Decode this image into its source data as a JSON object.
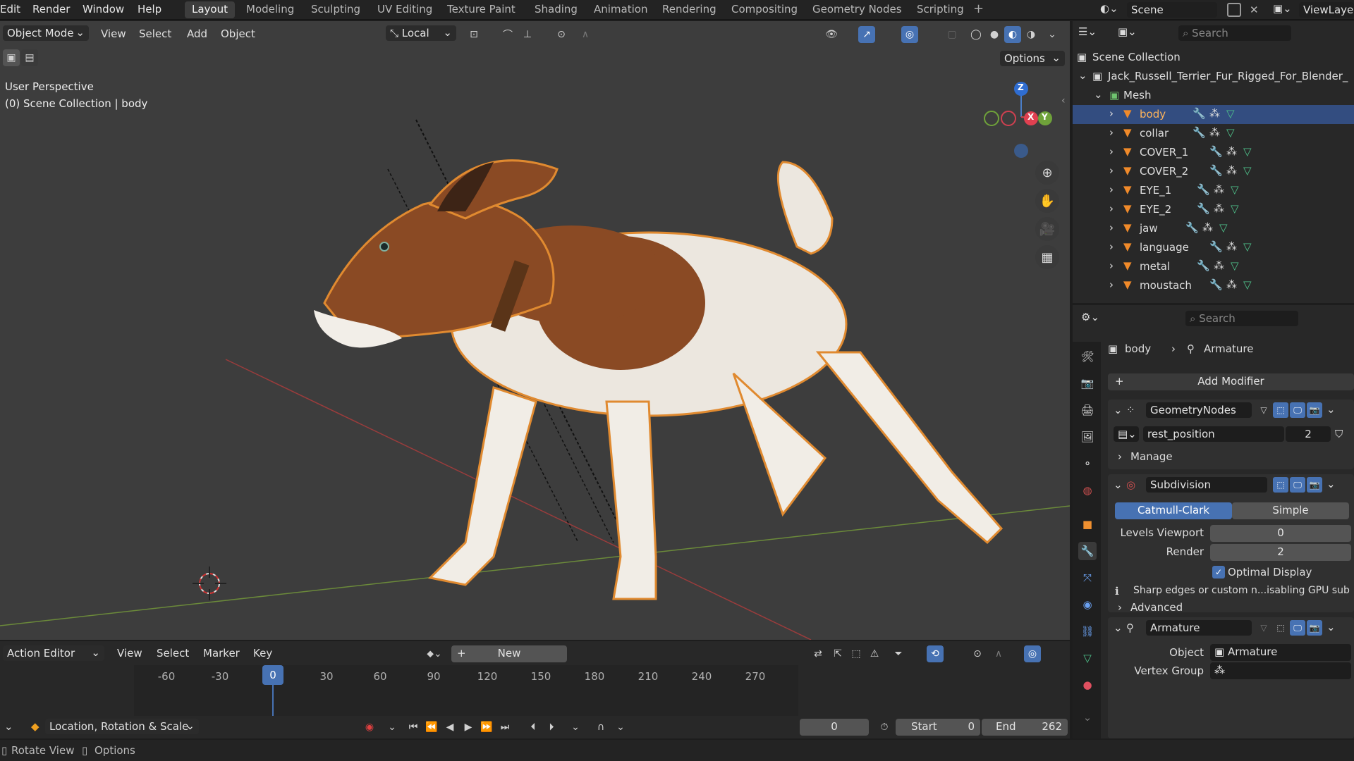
{
  "topmenu": {
    "edit": "Edit",
    "render": "Render",
    "window": "Window",
    "help": "Help"
  },
  "workspaces": [
    "Layout",
    "Modeling",
    "Sculpting",
    "UV Editing",
    "Texture Paint",
    "Shading",
    "Animation",
    "Rendering",
    "Compositing",
    "Geometry Nodes",
    "Scripting"
  ],
  "scene": {
    "label": "Scene",
    "viewlayer": "ViewLaye"
  },
  "viewport": {
    "mode": "Object Mode",
    "menus": {
      "view": "View",
      "select": "Select",
      "add": "Add",
      "object": "Object"
    },
    "orientation": "Local",
    "options": "Options",
    "perspective": "User Perspective",
    "collection_info": "(0) Scene Collection | body",
    "gizmo": {
      "z": "Z",
      "x": "X",
      "y": "Y"
    }
  },
  "outliner": {
    "search_placeholder": "Search",
    "scene_collection": "Scene Collection",
    "root": "Jack_Russell_Terrier_Fur_Rigged_For_Blender_",
    "mesh": "Mesh",
    "objects": [
      "body",
      "collar",
      "COVER_1",
      "COVER_2",
      "EYE_1",
      "EYE_2",
      "jaw",
      "language",
      "metal",
      "moustach"
    ]
  },
  "properties": {
    "search_placeholder": "Search",
    "breadcrumb_obj": "body",
    "breadcrumb_mod": "Armature",
    "add_modifier": "Add Modifier",
    "geonodes": {
      "name": "GeometryNodes",
      "attribute": "rest_position",
      "users": "2",
      "manage": "Manage"
    },
    "subdivision": {
      "name": "Subdivision",
      "catmull": "Catmull-Clark",
      "simple": "Simple",
      "levels_label": "Levels Viewport",
      "levels": "0",
      "render_label": "Render",
      "render": "2",
      "optimal": "Optimal Display",
      "warning": "Sharp edges or custom n...isabling GPU sub",
      "advanced": "Advanced"
    },
    "armature": {
      "name": "Armature",
      "object_label": "Object",
      "object": "Armature",
      "vgroup_label": "Vertex Group"
    }
  },
  "timeline": {
    "editor": "Action Editor",
    "menus": {
      "view": "View",
      "select": "Select",
      "marker": "Marker",
      "key": "Key"
    },
    "new": "New",
    "ticks": [
      "-60",
      "-30",
      "0",
      "30",
      "60",
      "90",
      "120",
      "150",
      "180",
      "210",
      "240",
      "270"
    ],
    "current": "0",
    "keying": "Location, Rotation & Scale",
    "frame": "0",
    "start_label": "Start",
    "start": "0",
    "end_label": "End",
    "end": "262"
  },
  "status": {
    "rotate": "Rotate View",
    "options": "Options"
  }
}
